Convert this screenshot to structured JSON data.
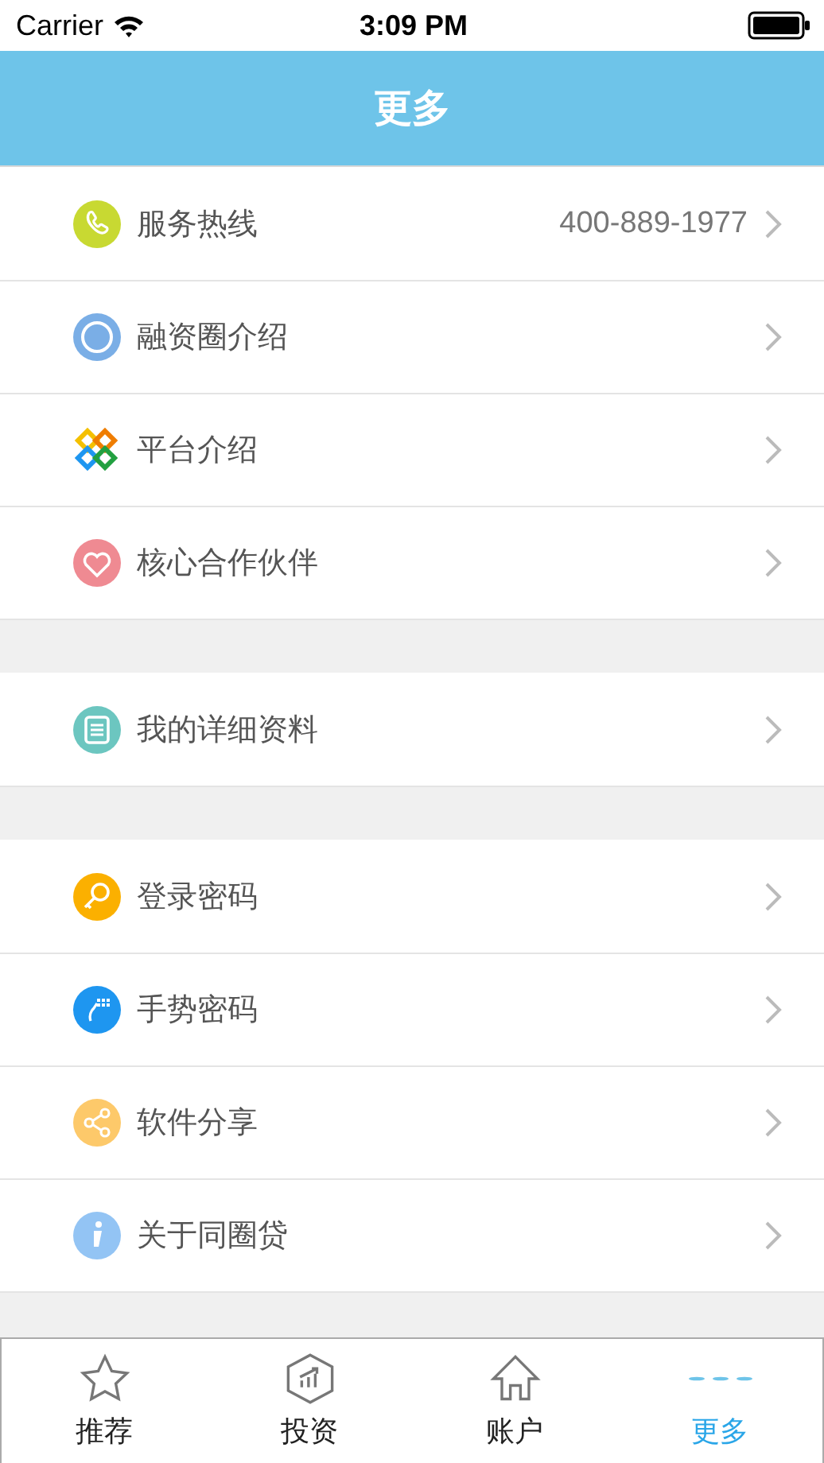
{
  "status_bar": {
    "carrier": "Carrier",
    "time": "3:09 PM"
  },
  "nav_bar": {
    "title": "更多"
  },
  "sections": [
    {
      "items": [
        {
          "label": "服务热线",
          "value": "400-889-1977"
        },
        {
          "label": "融资圈介绍"
        },
        {
          "label": "平台介绍"
        },
        {
          "label": "核心合作伙伴"
        }
      ]
    },
    {
      "items": [
        {
          "label": "我的详细资料"
        }
      ]
    },
    {
      "items": [
        {
          "label": "登录密码"
        },
        {
          "label": "手势密码"
        },
        {
          "label": "软件分享"
        },
        {
          "label": "关于同圈贷"
        }
      ]
    }
  ],
  "tab_bar": [
    {
      "label": "推荐",
      "selected": false
    },
    {
      "label": "投资",
      "selected": false
    },
    {
      "label": "账户",
      "selected": false
    },
    {
      "label": "更多",
      "selected": true
    }
  ]
}
